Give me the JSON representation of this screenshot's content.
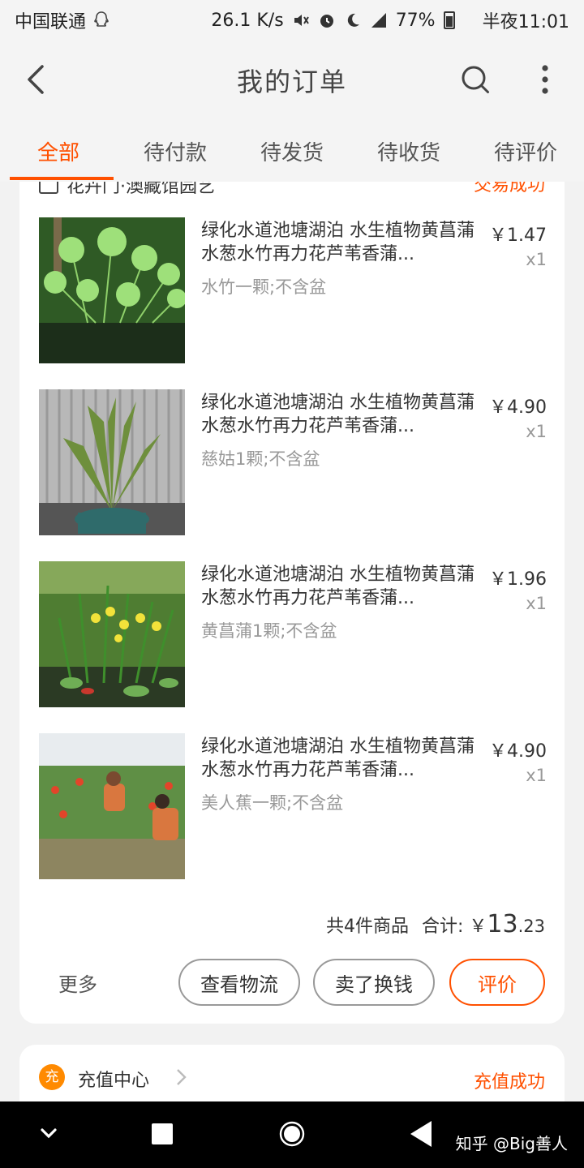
{
  "status_bar": {
    "carrier": "中国联通",
    "speed": "26.1 K/s",
    "battery": "77%",
    "time": "半夜11:01"
  },
  "header": {
    "title": "我的订单"
  },
  "tabs": [
    {
      "label": "全部",
      "active": true
    },
    {
      "label": "待付款",
      "active": false
    },
    {
      "label": "待发货",
      "active": false
    },
    {
      "label": "待收货",
      "active": false
    },
    {
      "label": "待评价",
      "active": false
    }
  ],
  "order": {
    "shop_name": "花卉门·澳藏馆园艺",
    "status": "交易成功",
    "items": [
      {
        "title": "绿化水道池塘湖泊 水生植物黄菖蒲水葱水竹再力花芦苇香蒲...",
        "sku": "水竹一颗;不含盆",
        "price": "￥1.47",
        "qty": "x1",
        "thumb": "papyrus"
      },
      {
        "title": "绿化水道池塘湖泊 水生植物黄菖蒲水葱水竹再力花芦苇香蒲...",
        "sku": "慈姑1颗;不含盆",
        "price": "￥4.90",
        "qty": "x1",
        "thumb": "arrowhead"
      },
      {
        "title": "绿化水道池塘湖泊 水生植物黄菖蒲水葱水竹再力花芦苇香蒲...",
        "sku": "黄菖蒲1颗;不含盆",
        "price": "￥1.96",
        "qty": "x1",
        "thumb": "yellow-iris"
      },
      {
        "title": "绿化水道池塘湖泊 水生植物黄菖蒲水葱水竹再力花芦苇香蒲...",
        "sku": "美人蕉一颗;不含盆",
        "price": "￥4.90",
        "qty": "x1",
        "thumb": "canna"
      }
    ],
    "summary": {
      "count_text": "共4件商品",
      "total_label": "合计:",
      "currency": "￥",
      "total_int": "13",
      "total_dec": ".23"
    },
    "actions": {
      "more": "更多",
      "logistics": "查看物流",
      "resell": "卖了换钱",
      "review": "评价"
    }
  },
  "recharge": {
    "icon_text": "充",
    "label": "充值中心",
    "status": "充值成功"
  },
  "watermark": "知乎 @Big善人",
  "colors": {
    "accent": "#ff5000"
  }
}
